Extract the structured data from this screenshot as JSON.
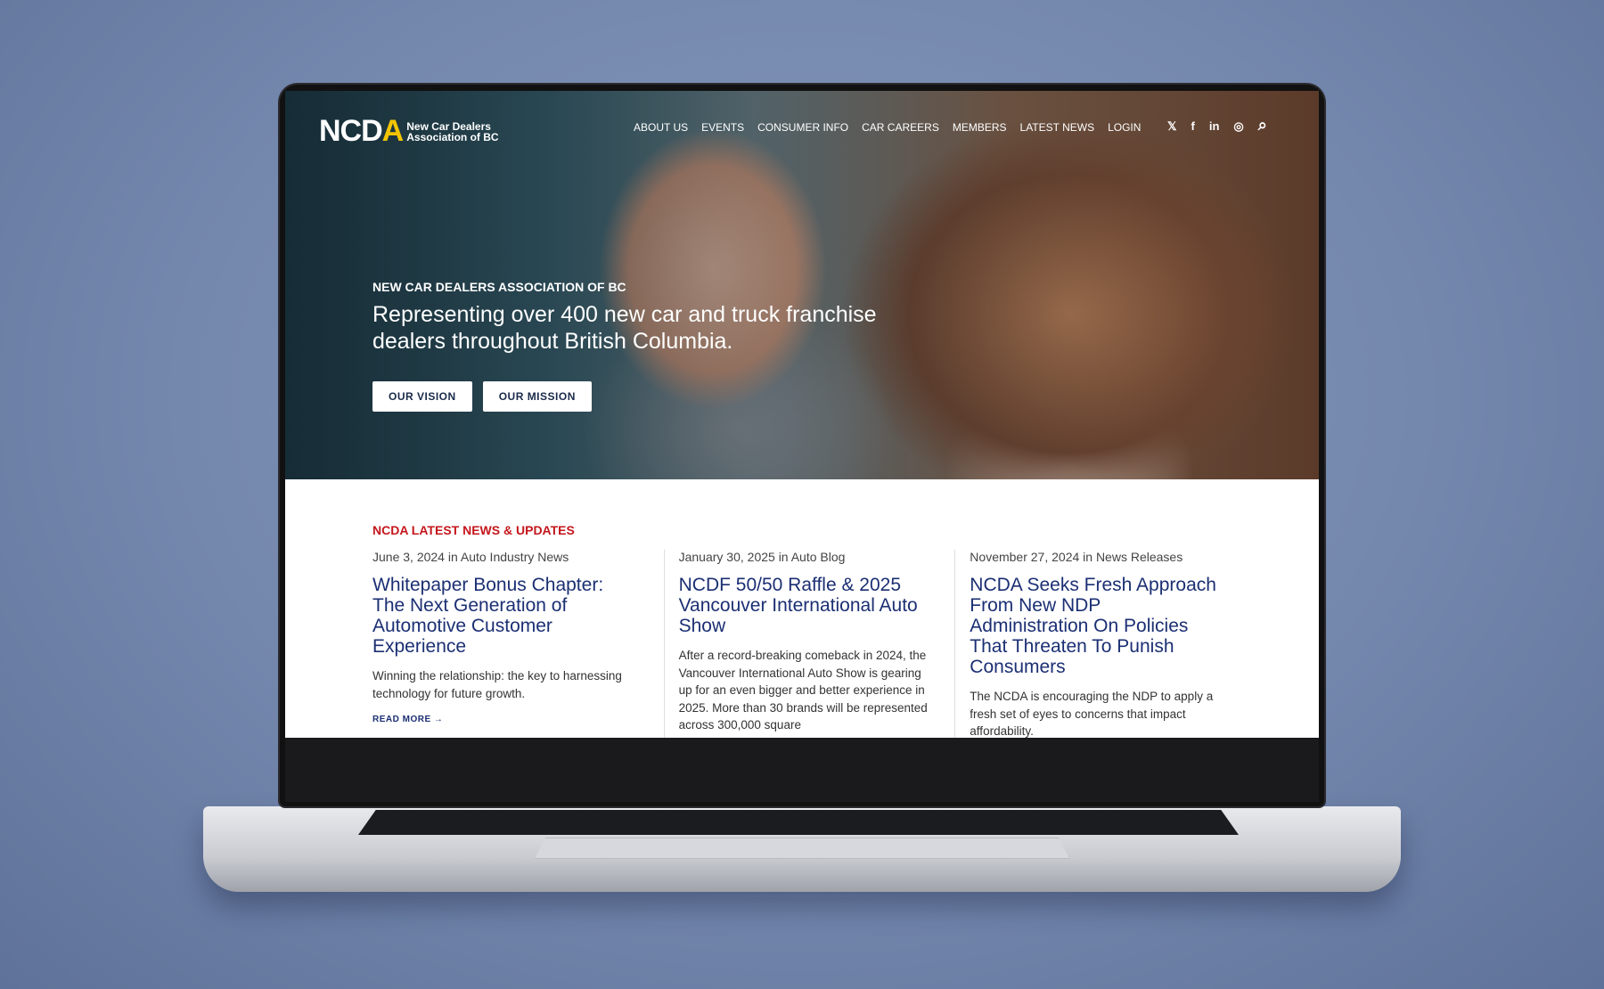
{
  "brand": {
    "mark": "NCDA",
    "name_line1": "New Car Dealers",
    "name_line2": "Association of BC"
  },
  "nav": [
    "ABOUT US",
    "EVENTS",
    "CONSUMER INFO",
    "CAR CAREERS",
    "MEMBERS",
    "LATEST NEWS",
    "LOGIN"
  ],
  "social": {
    "x": "𝕏",
    "facebook": "f",
    "linkedin": "in",
    "instagram": "◎",
    "search": "⌕"
  },
  "hero": {
    "eyebrow": "NEW CAR DEALERS ASSOCIATION OF BC",
    "headline": "Representing over 400 new car and truck franchise dealers throughout British Columbia.",
    "buttons": [
      "OUR VISION",
      "OUR MISSION"
    ]
  },
  "news": {
    "label": "NCDA LATEST NEWS & UPDATES",
    "label_color": "#c4161c",
    "articles": [
      {
        "meta": "June 3, 2024 in Auto Industry News",
        "title": "Whitepaper Bonus Chapter: The Next Generation of Automotive Customer Experience",
        "excerpt": "Winning the relationship: the key to harnessing technology for future growth.",
        "more": "READ MORE →"
      },
      {
        "meta": "January 30, 2025 in Auto Blog",
        "title": "NCDF 50/50 Raffle & 2025 Vancouver International Auto Show",
        "excerpt": "After a record-breaking comeback in 2024, the Vancouver International Auto Show is gearing up for an even bigger and better experience in 2025. More than 30 brands will be represented across 300,000 square"
      },
      {
        "meta": "November 27, 2024 in News Releases",
        "title": "NCDA Seeks Fresh Approach From New NDP Administration On Policies That Threaten To Punish Consumers",
        "excerpt": "The NCDA is encouraging the NDP to apply a fresh set of eyes to concerns that impact affordability."
      }
    ]
  }
}
